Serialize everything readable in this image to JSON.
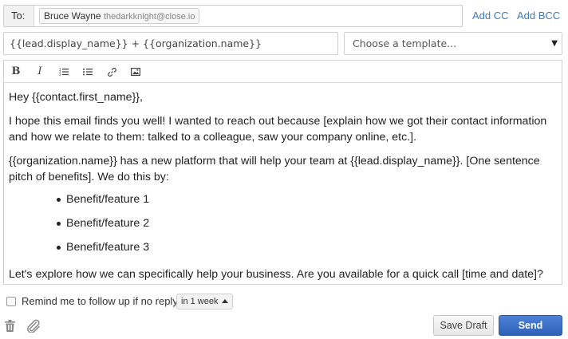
{
  "header": {
    "to_label": "To:",
    "recipient": {
      "name": "Bruce Wayne",
      "email": "thedarkknight@close.io"
    },
    "add_cc_label": "Add CC",
    "add_bcc_label": "Add BCC"
  },
  "subject": {
    "value": "{{lead.display_name}} + {{organization.name}}"
  },
  "template": {
    "selected": "Choose a template..."
  },
  "toolbar": {
    "bold": "B",
    "italic": "I",
    "icons": [
      "bold-icon",
      "italic-icon",
      "ordered-list-icon",
      "unordered-list-icon",
      "link-icon",
      "image-icon"
    ]
  },
  "body": {
    "greeting": "Hey {{contact.first_name}},",
    "paragraph1": "I hope this email finds you well! I wanted to reach out because [explain how we got their contact information and how we relate to them: talked to a colleague, saw your company online, etc.].",
    "paragraph2": "{{organization.name}} has a new platform that will help your team at {{lead.display_name}}. [One sentence pitch of benefits]. We do this by:",
    "benefits": [
      "Benefit/feature 1",
      "Benefit/feature 2",
      "Benefit/feature 3"
    ],
    "closing": "Let's explore how we can specifically help your business. Are you available for a quick call [time and date]?"
  },
  "reminder": {
    "label": "Remind me to follow up if no reply",
    "checked": false,
    "duration": "in 1 week"
  },
  "footer": {
    "save_draft_label": "Save Draft",
    "send_label": "Send",
    "icons": [
      "trash-icon",
      "paperclip-icon"
    ]
  },
  "colors": {
    "link": "#3b7bc0",
    "send_button": "#2e62b8",
    "border": "#cfcfcf"
  }
}
